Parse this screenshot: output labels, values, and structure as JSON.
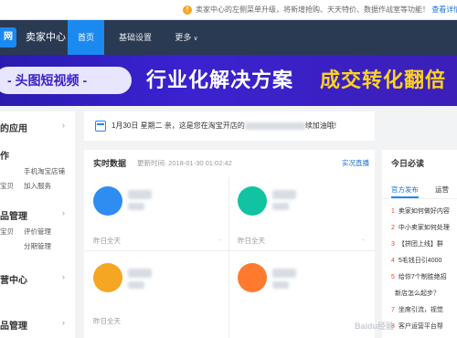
{
  "notice": {
    "text": "卖家中心的左侧菜单升级，将新增抢购、天天特价、数据作战室等功能！",
    "link": "查看详情"
  },
  "topnav": {
    "logo_char": "网",
    "title": "卖家中心",
    "items": [
      {
        "label": "首页",
        "active": true
      },
      {
        "label": "基础设置",
        "active": false
      },
      {
        "label": "更多",
        "active": false
      }
    ]
  },
  "banner": {
    "left_text": "- 头图短视频 -",
    "middle_text": "行业化解决方案",
    "right_text": "成交转化翻倍"
  },
  "sidebar": {
    "sections": [
      {
        "heading": "的应用",
        "links": []
      },
      {
        "heading": "作",
        "links": [
          "手机淘宝店铺",
          "宝贝",
          "加入服务"
        ]
      },
      {
        "heading": "品管理",
        "links": [
          "宝贝",
          "评价管理",
          "分期管理"
        ]
      },
      {
        "heading": "营中心",
        "links": []
      },
      {
        "heading": "品管理",
        "links": []
      }
    ]
  },
  "datebar": {
    "date": "1月30日 星期二",
    "greeting": "亲，这是您在淘宝开店的",
    "suffix": "续加油哦!"
  },
  "realtime": {
    "title": "实时数据",
    "update_label": "更新时间: 2018-01-30 01:02:42",
    "live_link": "实况直播",
    "cells": [
      {
        "footer": "昨日全天",
        "dash": "-",
        "color": "#2f8cf0"
      },
      {
        "footer": "昨日全天",
        "dash": "-",
        "color": "#12c3a1"
      },
      {
        "footer": "昨日全天",
        "dash": "",
        "color": "#f5a623"
      },
      {
        "footer": "",
        "dash": "",
        "color": "#ff7a2f"
      }
    ]
  },
  "today": {
    "title": "今日必读",
    "tabs": [
      "官方发布",
      "运营"
    ],
    "items": [
      {
        "num": "1",
        "text": "卖家如何做好内容"
      },
      {
        "num": "2",
        "text": "中小卖家如何处理"
      },
      {
        "num": "3",
        "text": "【拼团上线】群"
      },
      {
        "num": "4",
        "text": "5毛钱日引4000"
      },
      {
        "num": "5",
        "text": "给你7个制胜绝招"
      },
      {
        "num": "",
        "text": "新店怎么起步？"
      },
      {
        "num": "7",
        "text": "坐席引流，视觉"
      },
      {
        "num": "8",
        "text": "客户运营平台帮"
      }
    ]
  },
  "watermark": "Baidu经验"
}
